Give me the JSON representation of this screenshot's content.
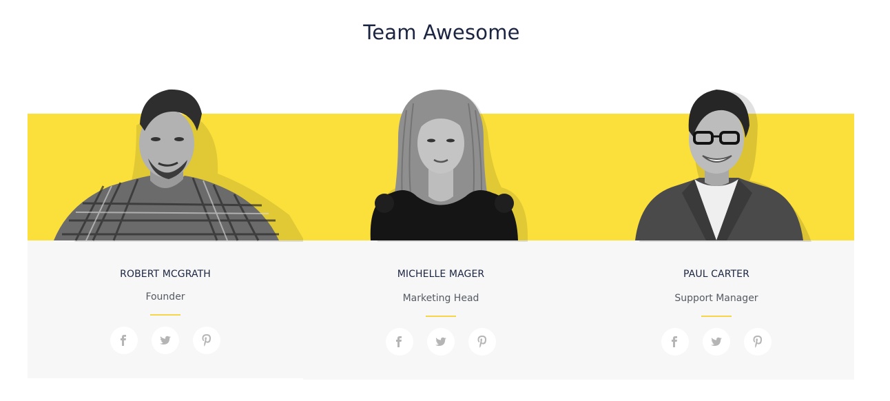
{
  "section": {
    "title": "Team Awesome"
  },
  "colors": {
    "accent_yellow": "#fbdf3b",
    "panel_gray": "#f7f7f7",
    "heading_navy": "#1b2440",
    "divider_yellow": "#f7d54a",
    "icon_gray": "#b5b5b5"
  },
  "team": [
    {
      "name": "ROBERT MCGRATH",
      "role": "Founder",
      "social": [
        "facebook-icon",
        "twitter-icon",
        "pinterest-icon"
      ]
    },
    {
      "name": "MICHELLE MAGER",
      "role": "Marketing Head",
      "social": [
        "facebook-icon",
        "twitter-icon",
        "pinterest-icon"
      ]
    },
    {
      "name": "PAUL CARTER",
      "role": "Support Manager",
      "social": [
        "facebook-icon",
        "twitter-icon",
        "pinterest-icon"
      ]
    }
  ]
}
